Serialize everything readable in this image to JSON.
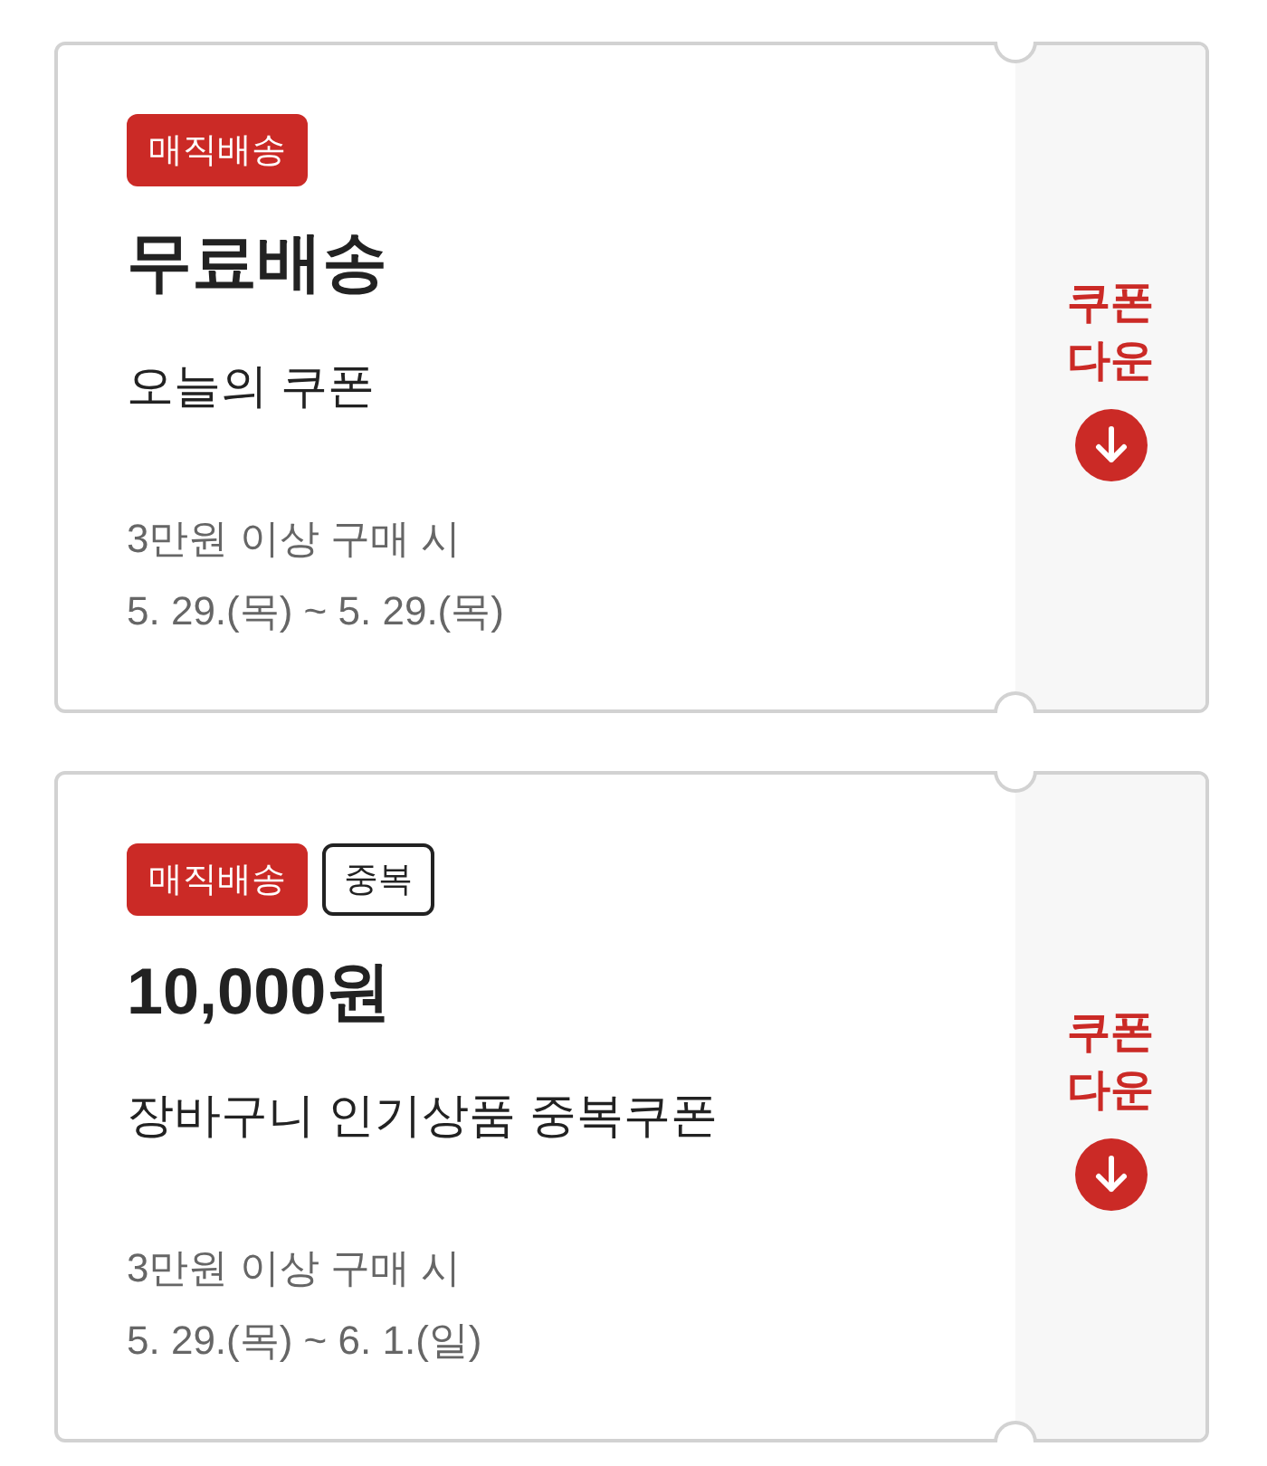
{
  "coupons": [
    {
      "badges": [
        {
          "label": "매직배송",
          "kind": "filled"
        }
      ],
      "title": "무료배송",
      "name": "오늘의 쿠폰",
      "condition": "3만원 이상 구매 시",
      "period": "5. 29.(목) ~ 5. 29.(목)",
      "download_label": "쿠폰 다운"
    },
    {
      "badges": [
        {
          "label": "매직배송",
          "kind": "filled"
        },
        {
          "label": "중복",
          "kind": "outline"
        }
      ],
      "title": "10,000원",
      "name": "장바구니 인기상품 중복쿠폰",
      "condition": "3만원 이상 구매 시",
      "period": "5. 29.(목) ~ 6. 1.(일)",
      "download_label": "쿠폰 다운"
    }
  ]
}
